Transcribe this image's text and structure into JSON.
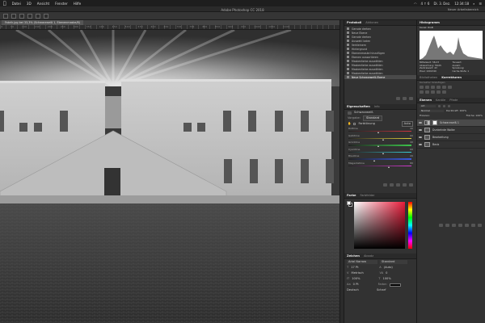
{
  "menubar": {
    "items": [
      "Datei",
      "3D",
      "Ansicht",
      "Fenster",
      "Hilfe"
    ],
    "status": [
      "4 ↑ 6",
      "Di. 3. Dez.",
      "12:34:18"
    ]
  },
  "window": {
    "title": "Adobe Photoshop CC 2018",
    "workspace": "Neuer Arbeitsbereich"
  },
  "document": {
    "tab_label": "Fabrik.jpg bei 33,3% (Schwarzweiß 1, Ebenenmaske/8)"
  },
  "ruler": {
    "labels": [
      "-0",
      "50",
      "100",
      "150",
      "200",
      "250",
      "300",
      "350",
      "400",
      "450",
      "500",
      "550",
      "600",
      "650",
      "700",
      "750",
      "800",
      "850",
      "900",
      "950",
      "1000",
      "1050",
      "1100"
    ]
  },
  "protokoll": {
    "tabs": [
      "Protokoll",
      "Aktionen"
    ],
    "items": [
      "Gerade drehen",
      "Neue Ebene",
      "Gerade drehen",
      "Auswahl laden",
      "Verkleinern",
      "Hintergrund",
      "Ebenenmaske hinzufügen",
      "Ebenen aussortieren",
      "Maskenfarbe auswählen",
      "Maskenfarbe auswählen",
      "Maskenfarbe auswählen",
      "Maskenfarbe auswählen",
      "Neue Schwarzweiß-Ebene"
    ]
  },
  "histogram": {
    "tabs": [
      "Histogramm",
      ""
    ],
    "channel": "Kanal: RGB",
    "stats_left": [
      "Mittelwert: 58,23",
      "Abweichung: 58,05",
      "Zentralwert: 43",
      "Pixel: 1001340"
    ],
    "stats_right": [
      "Tonwert:",
      "Anzahl:",
      "Spreizung:",
      "Cache-Stufe: 1"
    ]
  },
  "styles": {
    "tabs": [
      "Bibliotheken",
      "Korrekturen"
    ],
    "add_label": "Korrektur hinzufügen"
  },
  "properties": {
    "tabs": [
      "Eigenschaften",
      "Info"
    ],
    "layer_type": "Schwarzweiß",
    "preset_label": "Vorgabe:",
    "preset_value": "Standard",
    "tint_label": "Farbtönung",
    "auto_label": "Auto",
    "sliders": [
      {
        "name": "Rottöne",
        "value": "40"
      },
      {
        "name": "Gelbtöne",
        "value": "60"
      },
      {
        "name": "Grüntöne",
        "value": "40"
      },
      {
        "name": "Cyantöne",
        "value": "60"
      },
      {
        "name": "Blautöne",
        "value": "20"
      },
      {
        "name": "Magentatöne",
        "value": "80"
      }
    ]
  },
  "layers": {
    "tabs": [
      "Ebenen",
      "Kanäle",
      "Pfade"
    ],
    "kind_label": "Art",
    "blend": "Normal",
    "opacity": "Deckkraft: 100%",
    "lock": "Fixieren:",
    "fill": "Fläche: 100%",
    "rows": [
      "Schwarzweiß 1",
      "Dunkelnde Wolke",
      "Bearbeitung",
      "Basis"
    ]
  },
  "color": {
    "tabs": [
      "Farbe",
      "Farbfelder"
    ]
  },
  "character": {
    "tabs": [
      "Zeichen",
      "Absatz"
    ],
    "font_family": "Arial Narrow",
    "font_style": "Standard",
    "size": "17 Pt",
    "leading": "(Auto)",
    "tracking_label": "Metrisch",
    "tracking_value": "0",
    "vscale": "100%",
    "hscale": "100%",
    "baseline": "0 Pt",
    "color_label": "Farbe:",
    "opt1": "Deutsch",
    "opt2": "Scharf"
  },
  "colors": {
    "accent_red": "#e81c3a",
    "panel": "#323232",
    "selected_row": "#4a4a4a"
  }
}
